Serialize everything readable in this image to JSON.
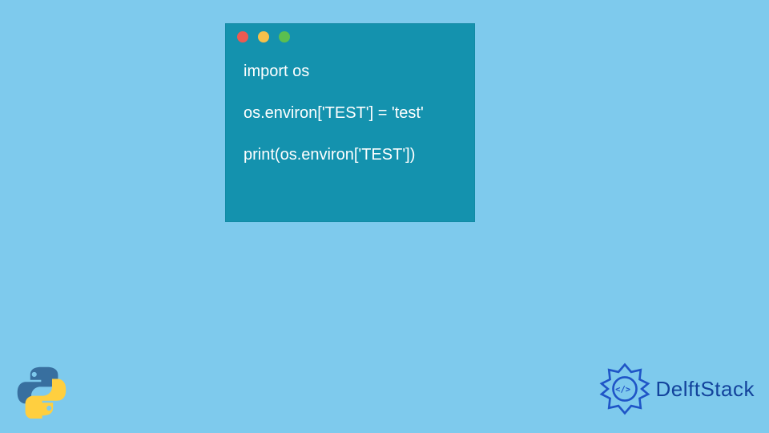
{
  "window": {
    "dots": {
      "red": "#ec5a52",
      "yellow": "#f6c14b",
      "green": "#5bbf50"
    },
    "code_lines": [
      "import os",
      "",
      "os.environ['TEST'] = 'test'",
      "",
      "print(os.environ['TEST'])"
    ]
  },
  "brand": {
    "name": "DelftStack"
  },
  "colors": {
    "page_bg": "#7ecaed",
    "window_bg": "#1492ae",
    "brand_text": "#13439c"
  }
}
